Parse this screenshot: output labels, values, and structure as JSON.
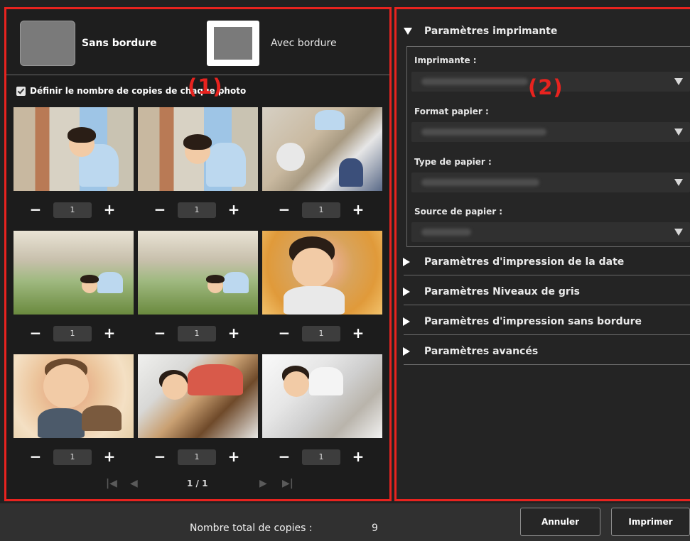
{
  "layout_options": {
    "borderless_label": "Sans bordure",
    "bordered_label": "Avec bordure"
  },
  "copies_checkbox": {
    "label": "Définir le nombre de copies de chaque photo",
    "checked": true
  },
  "callouts": {
    "one": "(1)",
    "two": "(2)"
  },
  "photos": [
    {
      "copies": "1"
    },
    {
      "copies": "1"
    },
    {
      "copies": "1"
    },
    {
      "copies": "1"
    },
    {
      "copies": "1"
    },
    {
      "copies": "1"
    },
    {
      "copies": "1"
    },
    {
      "copies": "1"
    },
    {
      "copies": "1"
    }
  ],
  "stepper": {
    "minus": "−",
    "plus": "+"
  },
  "pager": {
    "first": "◀",
    "prev": "◀",
    "page": "1 / 1",
    "next": "▶",
    "last": "▶"
  },
  "printer_settings": {
    "title": "Paramètres imprimante",
    "printer_label": "Imprimante :",
    "paper_size_label": "Format papier :",
    "paper_type_label": "Type de papier :",
    "paper_source_label": "Source de papier :"
  },
  "sections": {
    "date": "Paramètres d'impression de la date",
    "grayscale": "Paramètres Niveaux de gris",
    "borderless": "Paramètres d'impression sans bordure",
    "advanced": "Paramètres avancés"
  },
  "footer": {
    "total_label": "Nombre total de copies :",
    "total_value": "9",
    "cancel": "Annuler",
    "print": "Imprimer"
  },
  "colors": {
    "highlight": "#e8231f",
    "panel": "#1c1c1c",
    "bar": "#303030"
  }
}
